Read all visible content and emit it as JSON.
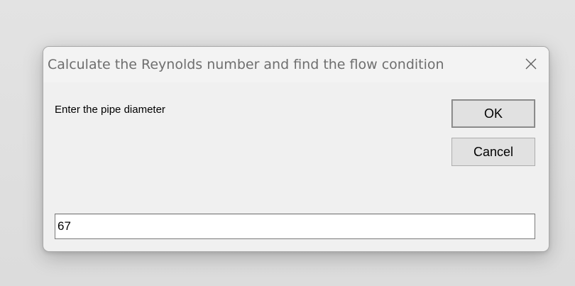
{
  "dialog": {
    "title": "Calculate the Reynolds number and find the flow condition",
    "close_icon": "close-icon",
    "prompt": "Enter the pipe diameter",
    "ok_label": "OK",
    "cancel_label": "Cancel",
    "input_value": "67"
  },
  "colors": {
    "backdrop": "#dedede",
    "dialog_bg": "#f0f0f0",
    "title_text": "#6e6e6e",
    "button_bg": "#e1e1e1"
  }
}
